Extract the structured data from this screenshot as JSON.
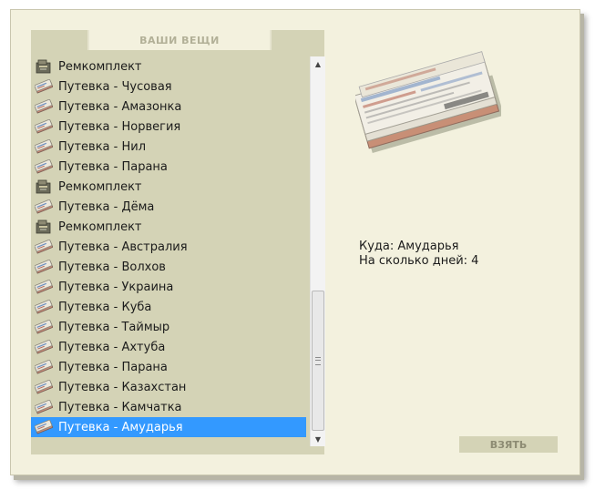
{
  "panel": {
    "title": "ВАШИ ВЕЩИ"
  },
  "items": [
    {
      "label": "Ремкомплект",
      "icon": "repair-kit-icon"
    },
    {
      "label": "Путевка - Чусовая",
      "icon": "voucher-icon"
    },
    {
      "label": "Путевка - Амазонка",
      "icon": "voucher-icon"
    },
    {
      "label": "Путевка - Норвегия",
      "icon": "voucher-icon"
    },
    {
      "label": "Путевка - Нил",
      "icon": "voucher-icon"
    },
    {
      "label": "Путевка - Парана",
      "icon": "voucher-icon"
    },
    {
      "label": "Ремкомплект",
      "icon": "repair-kit-icon"
    },
    {
      "label": "Путевка - Дёма",
      "icon": "voucher-icon"
    },
    {
      "label": "Ремкомплект",
      "icon": "repair-kit-icon"
    },
    {
      "label": "Путевка - Австралия",
      "icon": "voucher-icon"
    },
    {
      "label": "Путевка - Волхов",
      "icon": "voucher-icon"
    },
    {
      "label": "Путевка - Украина",
      "icon": "voucher-icon"
    },
    {
      "label": "Путевка - Куба",
      "icon": "voucher-icon"
    },
    {
      "label": "Путевка - Таймыр",
      "icon": "voucher-icon"
    },
    {
      "label": "Путевка - Ахтуба",
      "icon": "voucher-icon"
    },
    {
      "label": "Путевка - Парана",
      "icon": "voucher-icon"
    },
    {
      "label": "Путевка - Казахстан",
      "icon": "voucher-icon"
    },
    {
      "label": "Путевка - Камчатка",
      "icon": "voucher-icon"
    },
    {
      "label": "Путевка - Амударья",
      "icon": "voucher-icon",
      "selected": true
    }
  ],
  "details": {
    "destination": "Куда: Амударья",
    "days": "На сколько дней: 4"
  },
  "take_button": {
    "label": "ВЗЯТЬ"
  },
  "colors": {
    "selection": "#3399ff",
    "panel": "#d4d3b6",
    "background": "#f3f1de"
  }
}
